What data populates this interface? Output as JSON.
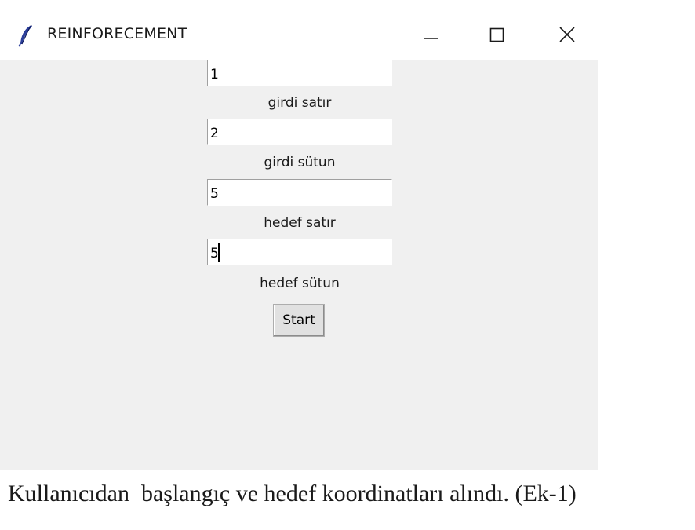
{
  "window": {
    "title": "REINFORECEMENT",
    "icon": "feather-icon",
    "controls": {
      "minimize_icon": "minimize-icon",
      "maximize_icon": "maximize-icon",
      "close_icon": "close-icon"
    },
    "background_color": "#f0f0f0"
  },
  "form": {
    "fields": [
      {
        "value": "1",
        "label": "girdi satır"
      },
      {
        "value": "2",
        "label": "girdi sütun"
      },
      {
        "value": "5",
        "label": "hedef satır"
      },
      {
        "value": "5",
        "label": "hedef sütun"
      }
    ],
    "start_label": "Start"
  },
  "caption": "Kullanıcıdan  başlangıç ve hedef koordinatları alındı. (Ek-1)"
}
